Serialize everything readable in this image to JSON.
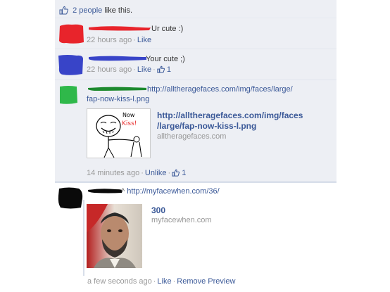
{
  "likes_bar": {
    "text_link": "2 people",
    "text_rest": " like this."
  },
  "comments": [
    {
      "text": "Ur cute :)",
      "time": "22 hours ago",
      "like": "Like",
      "like_count": "",
      "avatar_color": "#e8242b",
      "scribble_color": "#e8242b"
    },
    {
      "text": "Your cute ;)",
      "time": "22 hours ago",
      "like": "Like",
      "like_count": "1",
      "avatar_color": "#3844c8",
      "scribble_color": "#3844c8"
    },
    {
      "text_line1": "http://alltheragefaces.com/img/faces/large/",
      "text_line2": "fap-now-kiss-l.png",
      "time": "14 minutes ago",
      "like": "Unlike",
      "like_count": "1",
      "avatar_color": "#2fb84a",
      "scribble_color": "#1e8a2e",
      "preview": {
        "title_line1": "http://alltheragefaces.com/img/faces",
        "title_line2": "/large/fap-now-kiss-l.png",
        "domain": "alltheragefaces.com",
        "bubble_text1": "Now",
        "bubble_text2": "Kiss!"
      }
    },
    {
      "text": "http://myfacewhen.com/36/",
      "time": "a few seconds ago",
      "like": "Like",
      "remove": "Remove Preview",
      "avatar_color": "#0a0a0a",
      "scribble_color": "#0a0a0a",
      "preview": {
        "title": "300",
        "domain": "myfacewhen.com"
      }
    }
  ],
  "colors": {
    "link": "#3b5998",
    "meta": "#999999",
    "panel": "#edeff4"
  }
}
